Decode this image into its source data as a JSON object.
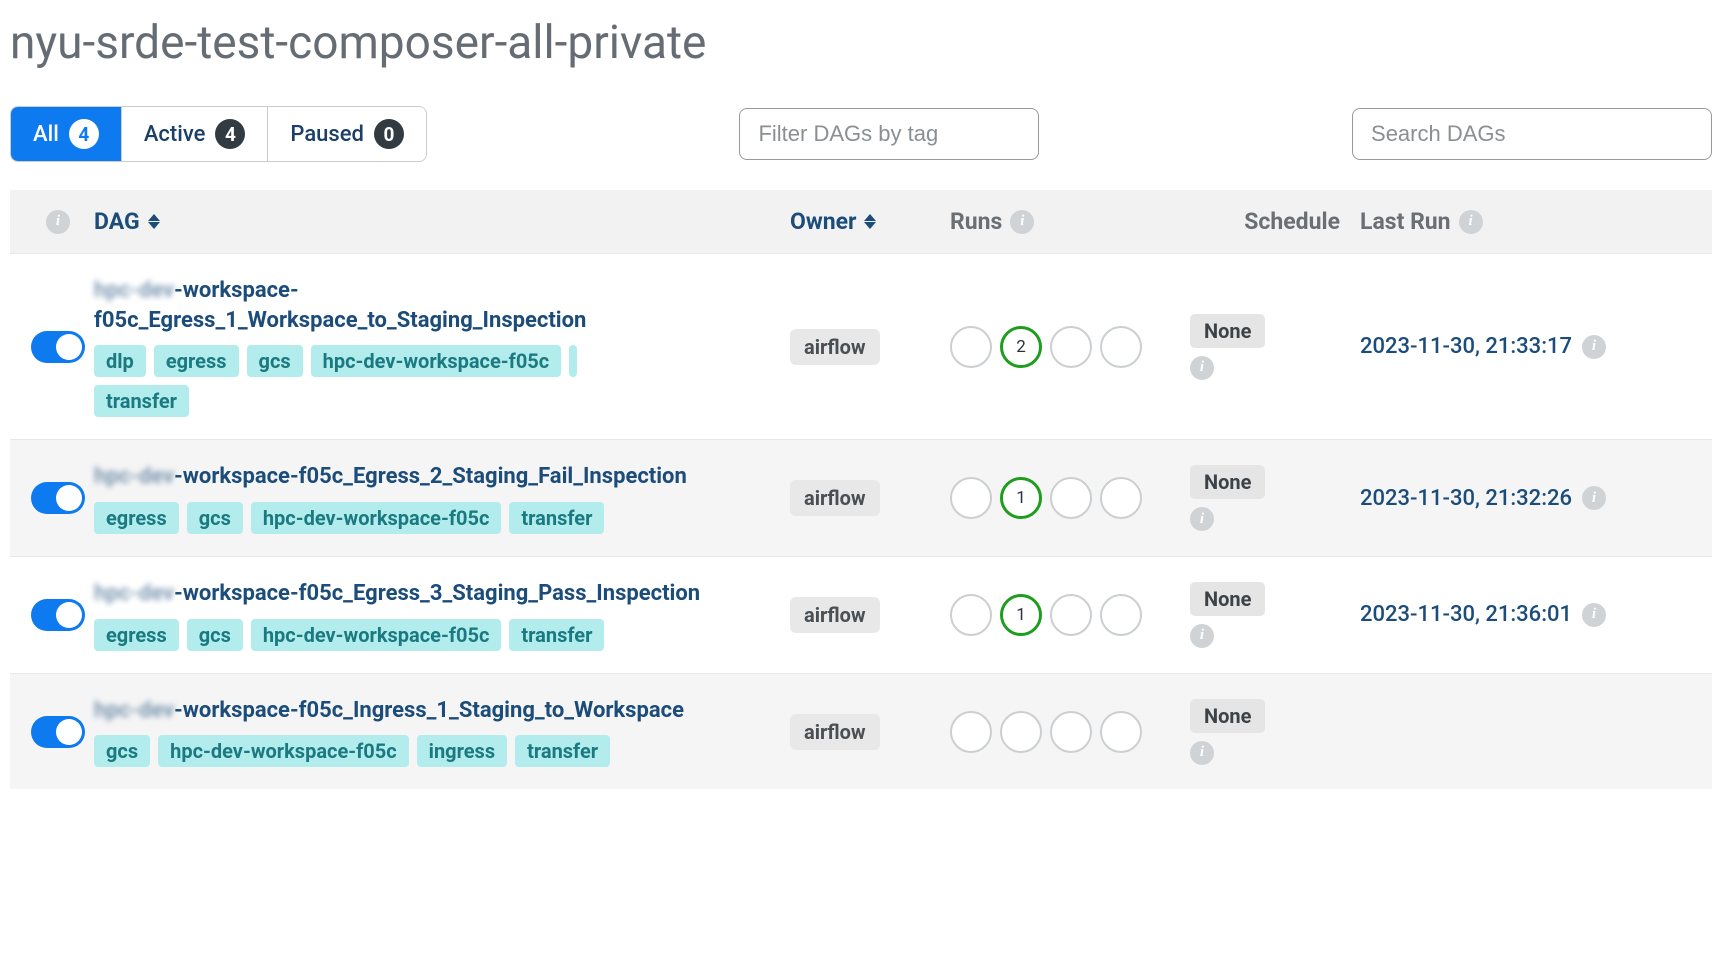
{
  "page_title": "nyu-srde-test-composer-all-private",
  "filter_tabs": {
    "all": {
      "label": "All",
      "count": "4"
    },
    "active": {
      "label": "Active",
      "count": "4"
    },
    "paused": {
      "label": "Paused",
      "count": "0"
    }
  },
  "filter_tags_placeholder": "Filter DAGs by tag",
  "search_placeholder": "Search DAGs",
  "columns": {
    "dag": "DAG",
    "owner": "Owner",
    "runs": "Runs",
    "schedule": "Schedule",
    "last_run": "Last Run"
  },
  "dags": [
    {
      "prefix": "hpc-dev",
      "name": "-workspace-f05c_Egress_1_Workspace_to_Staging_Inspection",
      "tags": [
        "dlp",
        "egress",
        "gcs",
        "hpc-dev-workspace-f05c"
      ],
      "extra_sliver": true,
      "tags_line2": [
        "transfer"
      ],
      "owner": "airflow",
      "runs_success": "2",
      "schedule": "None",
      "last_run": "2023-11-30, 21:33:17"
    },
    {
      "prefix": "hpc-dev",
      "name": "-workspace-f05c_Egress_2_Staging_Fail_Inspection",
      "tags": [
        "egress",
        "gcs",
        "hpc-dev-workspace-f05c",
        "transfer"
      ],
      "extra_sliver": false,
      "tags_line2": [],
      "owner": "airflow",
      "runs_success": "1",
      "schedule": "None",
      "last_run": "2023-11-30, 21:32:26"
    },
    {
      "prefix": "hpc-dev",
      "name": "-workspace-f05c_Egress_3_Staging_Pass_Inspection",
      "tags": [
        "egress",
        "gcs",
        "hpc-dev-workspace-f05c",
        "transfer"
      ],
      "extra_sliver": false,
      "tags_line2": [],
      "owner": "airflow",
      "runs_success": "1",
      "schedule": "None",
      "last_run": "2023-11-30, 21:36:01"
    },
    {
      "prefix": "hpc-dev",
      "name": "-workspace-f05c_Ingress_1_Staging_to_Workspace",
      "tags": [
        "gcs",
        "hpc-dev-workspace-f05c",
        "ingress",
        "transfer"
      ],
      "extra_sliver": false,
      "tags_line2": [],
      "owner": "airflow",
      "runs_success": "",
      "schedule": "None",
      "last_run": ""
    }
  ]
}
